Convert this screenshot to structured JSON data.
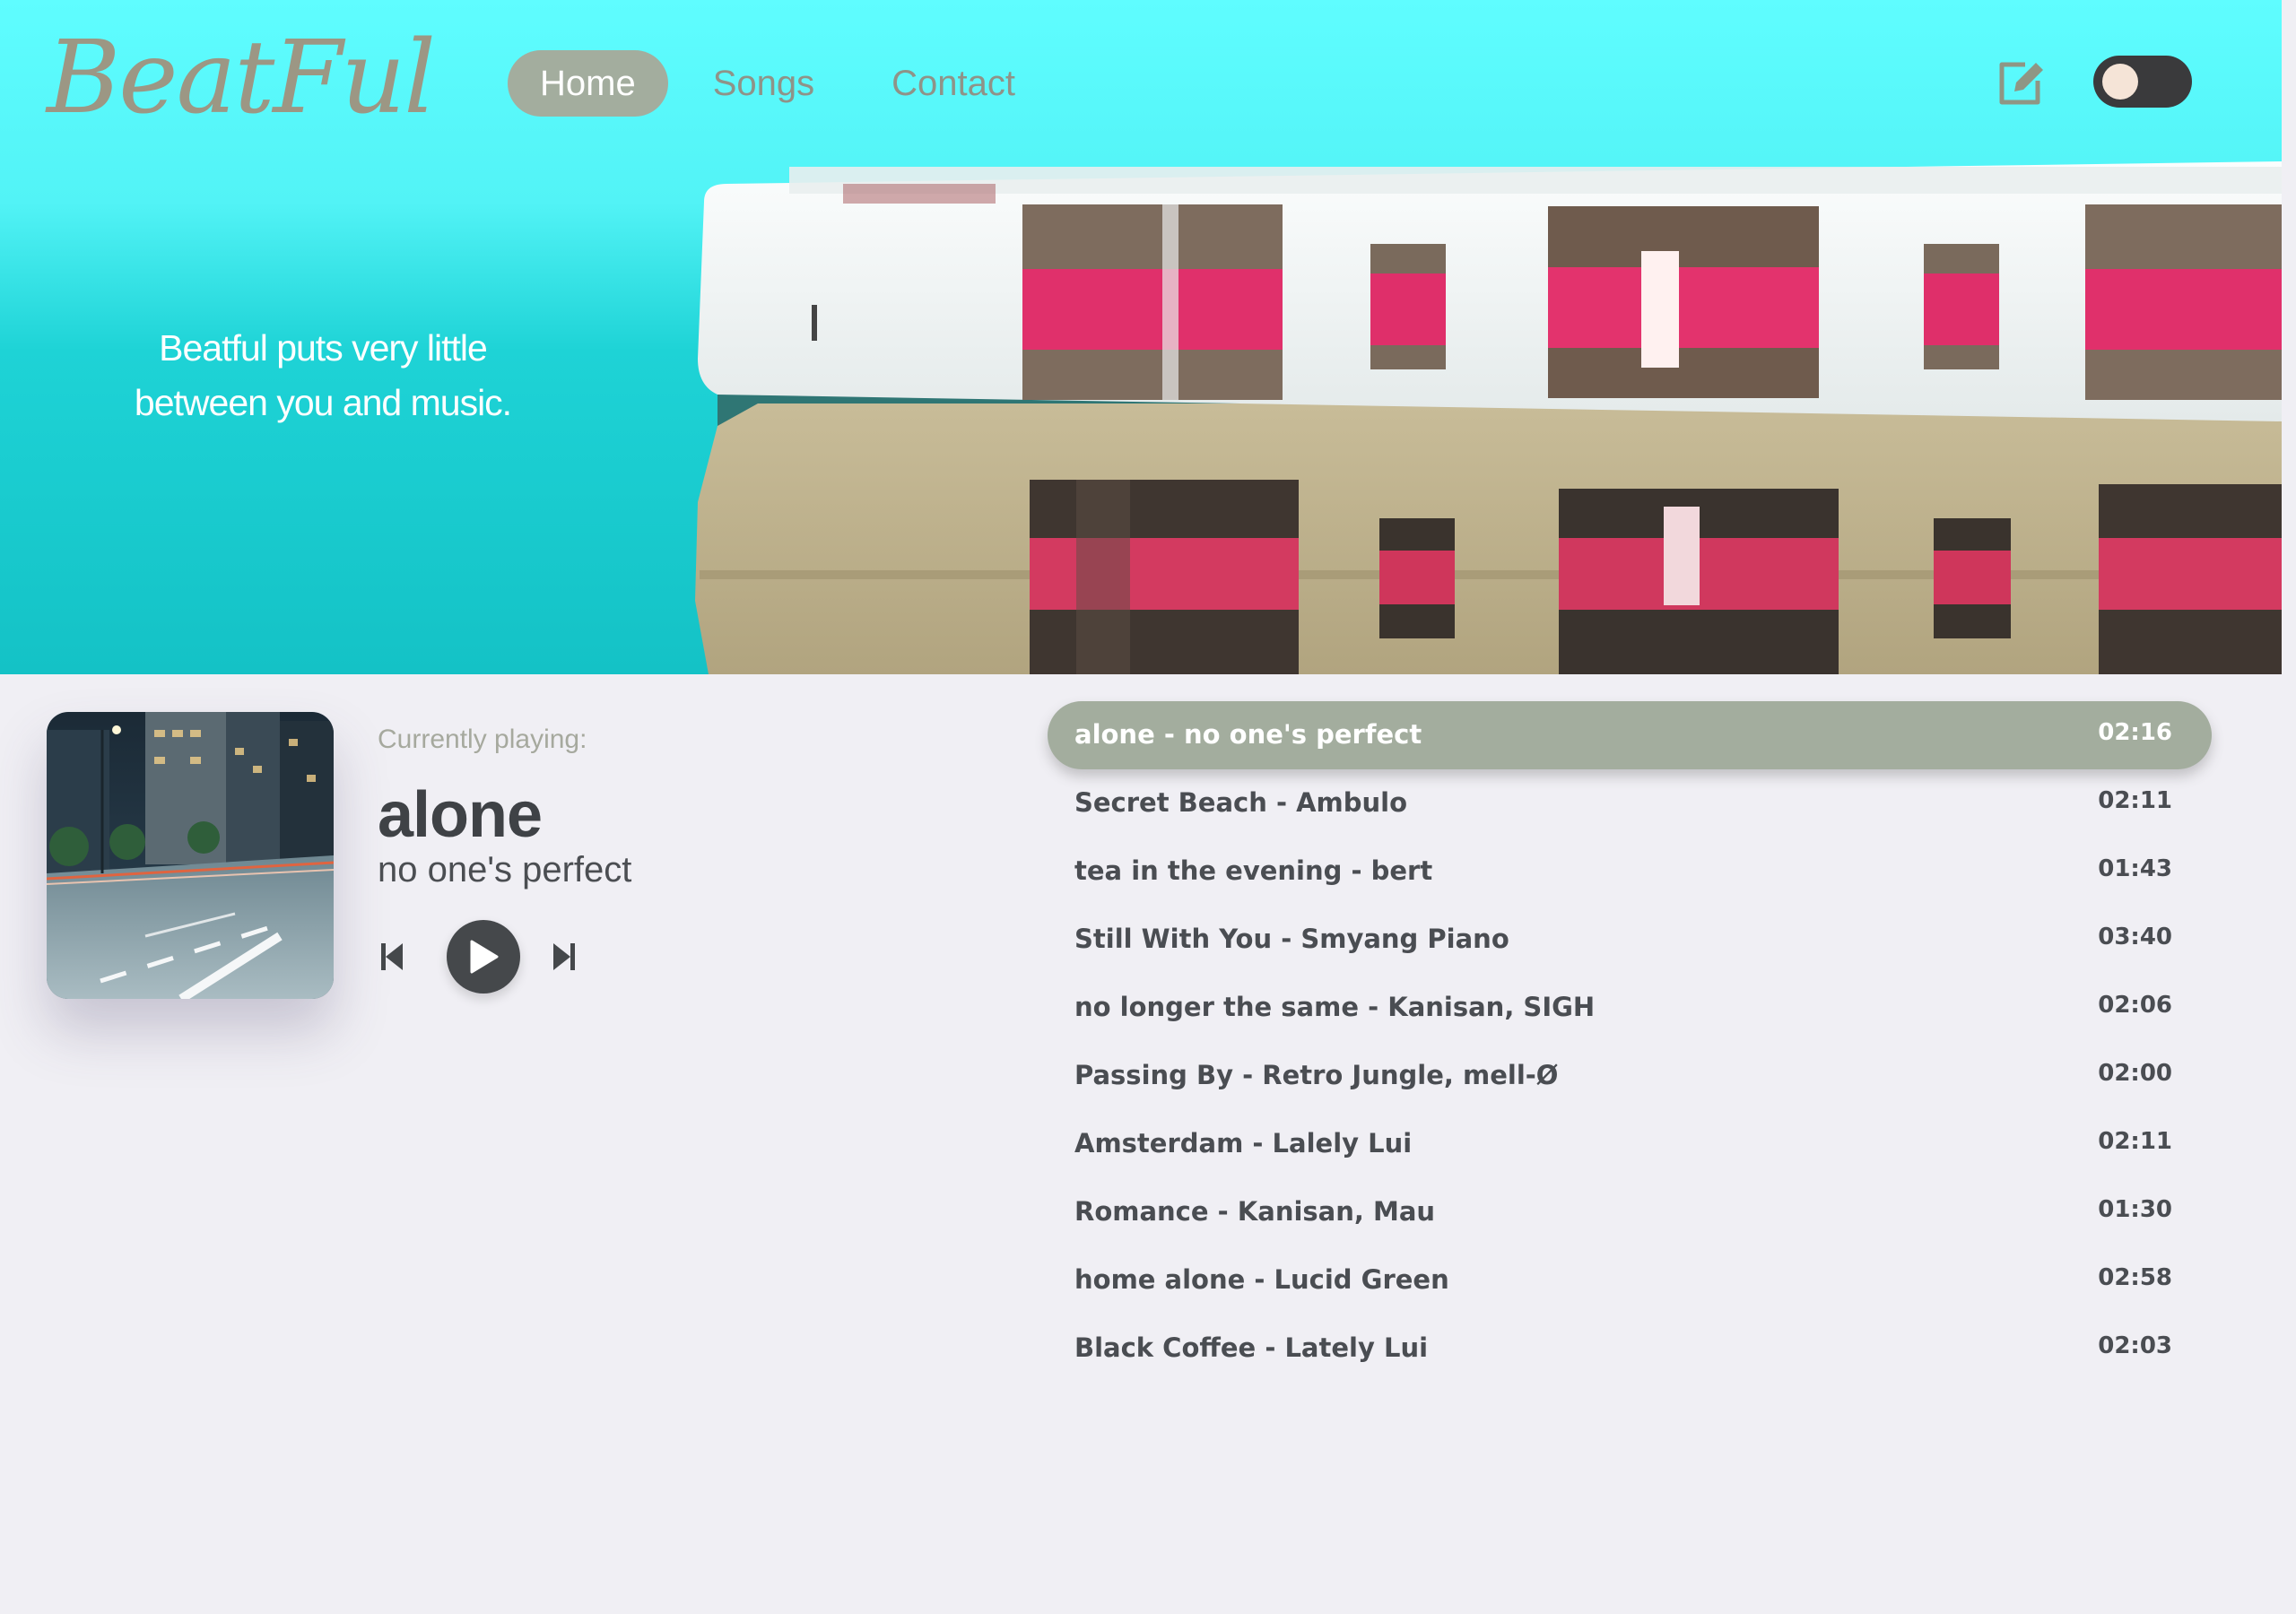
{
  "brand": {
    "logo": "BeatFul"
  },
  "nav": {
    "items": [
      {
        "label": "Home",
        "active": true
      },
      {
        "label": "Songs",
        "active": false
      },
      {
        "label": "Contact",
        "active": false
      }
    ]
  },
  "header_actions": {
    "edit_icon": "edit-icon",
    "theme_toggle": {
      "state": "off"
    }
  },
  "hero": {
    "tagline_line1": "Beatful puts very little",
    "tagline_line2": "between you and music."
  },
  "player": {
    "label": "Currently playing:",
    "title": "alone",
    "artist": "no one's perfect",
    "controls": [
      "previous-icon",
      "play-icon",
      "next-icon"
    ]
  },
  "playlist": [
    {
      "name": "alone - no one's perfect",
      "duration": "02:16",
      "active": true
    },
    {
      "name": "Secret Beach - Ambulo",
      "duration": "02:11",
      "active": false
    },
    {
      "name": "tea in the evening - bert",
      "duration": "01:43",
      "active": false
    },
    {
      "name": "Still With You - Smyang Piano",
      "duration": "03:40",
      "active": false
    },
    {
      "name": "no longer the same - Kanisan, SIGH",
      "duration": "02:06",
      "active": false
    },
    {
      "name": "Passing By - Retro Jungle, mell-Ø",
      "duration": "02:00",
      "active": false
    },
    {
      "name": "Amsterdam - Lalely Lui",
      "duration": "02:11",
      "active": false
    },
    {
      "name": "Romance - Kanisan, Mau",
      "duration": "01:30",
      "active": false
    },
    {
      "name": "home alone - Lucid Green",
      "duration": "02:58",
      "active": false
    },
    {
      "name": "Black Coffee - Lately Lui",
      "duration": "02:03",
      "active": false
    }
  ],
  "colors": {
    "accent": "#a3ad9e",
    "hero_cyan": "#52f3f6",
    "background": "#f0eff4",
    "text_dark": "#4a4d52"
  }
}
